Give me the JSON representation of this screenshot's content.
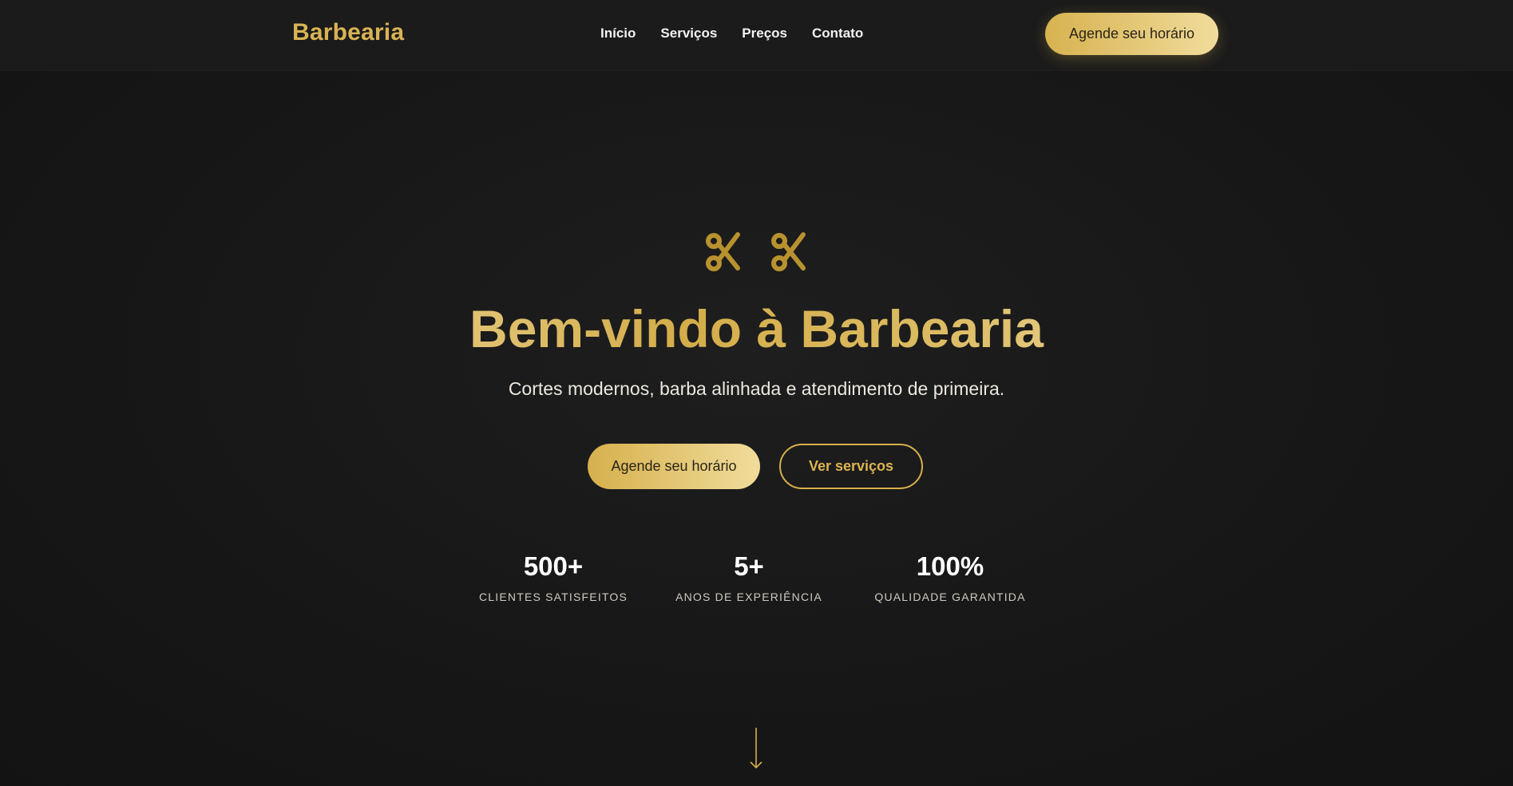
{
  "header": {
    "logo": "Barbearia",
    "nav": [
      {
        "label": "Início"
      },
      {
        "label": "Serviços"
      },
      {
        "label": "Preços"
      },
      {
        "label": "Contato"
      }
    ],
    "cta_label": "Agende seu horário"
  },
  "hero": {
    "icons": [
      "scissors-icon",
      "scissors-icon"
    ],
    "title": "Bem-vindo à Barbearia",
    "subtitle": "Cortes modernos, barba alinhada e atendimento de primeira.",
    "primary_button": "Agende seu horário",
    "secondary_button": "Ver serviços",
    "stats": [
      {
        "value": "500+",
        "label": "CLIENTES SATISFEITOS"
      },
      {
        "value": "5+",
        "label": "ANOS DE EXPERIÊNCIA"
      },
      {
        "value": "100%",
        "label": "QUALIDADE GARANTIDA"
      }
    ],
    "scroll_icon": "arrow-down-icon"
  },
  "colors": {
    "background": "#161616",
    "header_bg": "#1b1b1b",
    "accent_gold": "#d6b04c",
    "accent_light": "#f0dc9b",
    "text": "#f2f2f2"
  }
}
